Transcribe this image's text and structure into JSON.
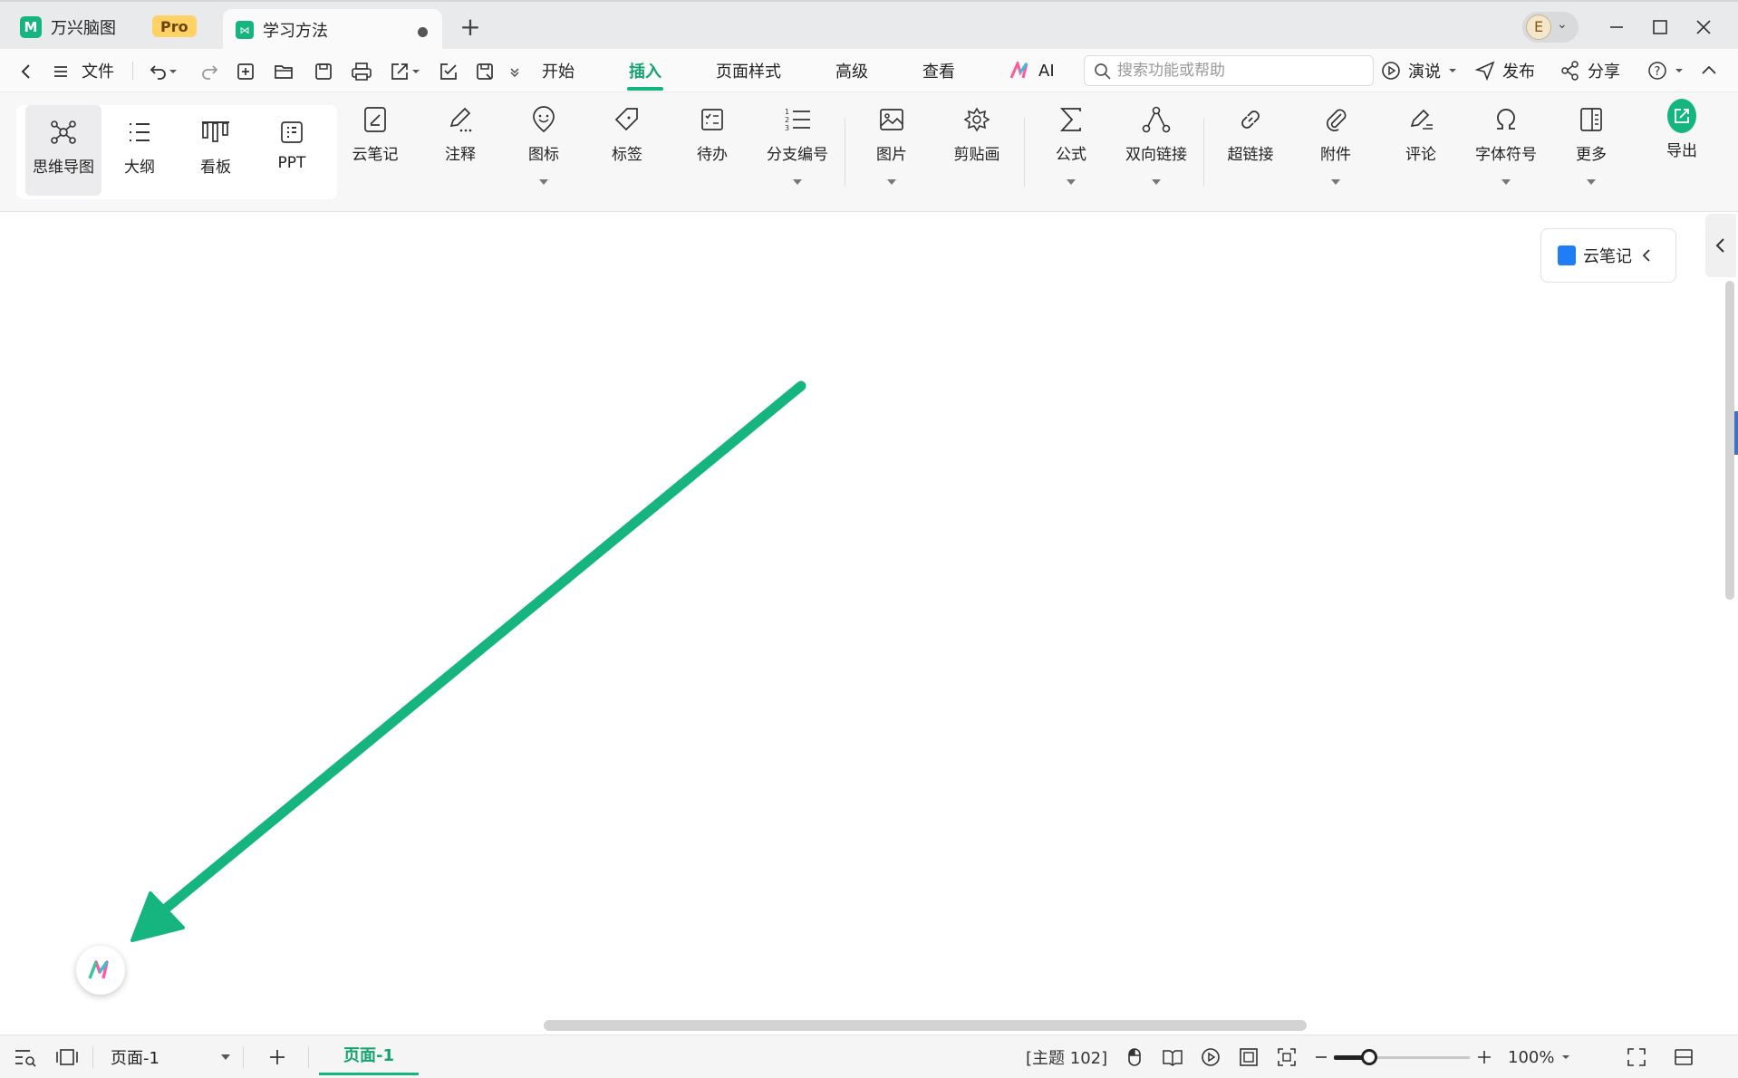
{
  "window": {
    "app_name": "万兴脑图",
    "badge": "Pro",
    "doc_tab_title": "学习方法",
    "user_initial": "E"
  },
  "menubar": {
    "file_label": "文件",
    "tabs": [
      "开始",
      "插入",
      "页面样式",
      "高级",
      "查看",
      "AI"
    ],
    "active_tab": "插入",
    "search_placeholder": "搜索功能或帮助",
    "right_items": {
      "present": "演说",
      "publish": "发布",
      "share": "分享"
    }
  },
  "ribbon": {
    "views": [
      {
        "label": "思维导图",
        "icon": "mindmap-icon",
        "selected": true
      },
      {
        "label": "大纲",
        "icon": "outline-icon"
      },
      {
        "label": "看板",
        "icon": "kanban-icon"
      },
      {
        "label": "PPT",
        "icon": "ppt-icon"
      }
    ],
    "tools": [
      {
        "label": "云笔记",
        "icon": "cloud-note-icon"
      },
      {
        "label": "注释",
        "icon": "annotation-icon"
      },
      {
        "label": "图标",
        "icon": "emoji-icon",
        "dropdown": true
      },
      {
        "label": "标签",
        "icon": "tag-icon"
      },
      {
        "label": "待办",
        "icon": "todo-icon"
      },
      {
        "label": "分支编号",
        "icon": "numbering-icon",
        "dropdown": true
      },
      {
        "label": "图片",
        "icon": "image-icon",
        "dropdown": true
      },
      {
        "label": "剪贴画",
        "icon": "clipart-icon"
      },
      {
        "label": "公式",
        "icon": "formula-icon",
        "dropdown": true
      },
      {
        "label": "双向链接",
        "icon": "bilink-icon",
        "dropdown": true
      },
      {
        "label": "超链接",
        "icon": "hyperlink-icon"
      },
      {
        "label": "附件",
        "icon": "attachment-icon",
        "dropdown": true
      },
      {
        "label": "评论",
        "icon": "comment-icon"
      },
      {
        "label": "字体符号",
        "icon": "symbol-icon",
        "dropdown": true
      },
      {
        "label": "更多",
        "icon": "more-icon",
        "dropdown": true
      }
    ],
    "export_label": "导出"
  },
  "canvas": {
    "cloud_note_panel_label": "云笔记",
    "arrow_color": "#16b47f"
  },
  "statusbar": {
    "page_select": "页面-1",
    "page_tab": "页面-1",
    "topic_count": "[主题 102]",
    "zoom": "100%"
  },
  "colors": {
    "accent": "#16b47f",
    "accent_text": "#16a36f",
    "pro_badge": "#ffd266"
  }
}
